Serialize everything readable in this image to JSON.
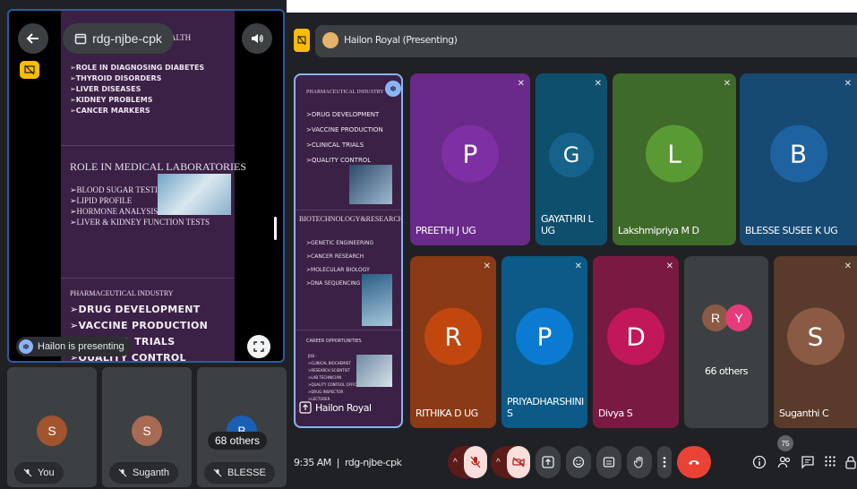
{
  "phone": {
    "meeting_code": "rdg-njbe-cpk",
    "presenting_label": "Hailon is presenting",
    "slide": {
      "top_heading": "HEALTH",
      "top_items": [
        "➢ROLE IN DIAGNOSING DIABETES",
        "➢THYROID DISORDERS",
        "➢LIVER DISEASES",
        "➢KIDNEY PROBLEMS",
        "➢CANCER MARKERS"
      ],
      "section_title": "ROLE IN MEDICAL LABORATORIES",
      "section_items": [
        "➢BLOOD SUGAR TESTING",
        "➢LIPID PROFILE",
        "➢HORMONE ANALYSIS",
        "➢LIVER & KIDNEY FUNCTION TESTS"
      ],
      "pharma_title": "PHARMACEUTICAL INDUSTRY",
      "pharma_items": [
        "➢DRUG DEVELOPMENT",
        "➢VACCINE PRODUCTION",
        "➢CLINICAL TRIALS",
        "➢QUALITY CONTROL"
      ]
    },
    "participants": [
      {
        "initial": "S",
        "name": "You"
      },
      {
        "initial": "S",
        "name": "Suganth"
      },
      {
        "initial": "B",
        "name": "BLESSE",
        "overlay": "68 others"
      }
    ]
  },
  "meet": {
    "presenter_bar": "Hailon Royal (Presenting)",
    "presentation": {
      "name": "Hailon Royal",
      "heading1": "PHARMACEUTICAL INDUSTRY",
      "items1": [
        ">DRUG DEVELOPMENT",
        ">VACCINE PRODUCTION",
        ">CLINICAL TRIALS",
        ">QUALITY CONTROL"
      ],
      "heading2": "BIOTECHNOLOGY&RESEARCH",
      "items2": [
        ">GENETIC ENGINEERING",
        ">CANCER RESEARCH",
        ">MOLECULAR BIOLOGY",
        ">DNA SEQUENCING"
      ],
      "heading3": "CAREER OPPORTUNITIES",
      "items3": [
        "JOB -",
        ">CLINICAL BIOCHEMIST",
        ">RESEARCH SCIENTIST",
        ">LAB TECHNICIAN",
        ">QUALITY CONTROL OFFICER",
        ">DRUG INSPECTOR",
        ">LECTURER"
      ]
    },
    "tiles_row1": [
      {
        "initial": "P",
        "name": "PREETHI J UG",
        "bg": "#6a2a8a",
        "av": "#7e2fa3"
      },
      {
        "initial": "G",
        "name": "GAYATHRI L UG",
        "bg": "#0f4f6e",
        "av": "#16628a"
      },
      {
        "initial": "L",
        "name": "Lakshmipriya M D",
        "bg": "#3f6b2a",
        "av": "#5a9a35"
      },
      {
        "initial": "B",
        "name": "BLESSE SUSEE K UG",
        "bg": "#164a73",
        "av": "#1f62a0"
      }
    ],
    "tiles_row2": [
      {
        "initial": "R",
        "name": "RITHIKA D UG",
        "bg": "#8a3a16",
        "av": "#c2470f"
      },
      {
        "initial": "P",
        "name": "PRIYADHARSHINI S",
        "bg": "#0b5a87",
        "av": "#0b7ad1"
      },
      {
        "initial": "D",
        "name": "Divya S",
        "bg": "#7a1a43",
        "av": "#c2185b"
      },
      {
        "initial": "S",
        "name": "Suganthi C",
        "bg": "#5a3a2a",
        "av": "#8a5a45"
      }
    ],
    "others": {
      "label": "66 others",
      "initial1": "R",
      "initial2": "Y"
    },
    "time": "9:35 AM",
    "separator": "|",
    "code": "rdg-njbe-cpk",
    "people_count": "75"
  }
}
